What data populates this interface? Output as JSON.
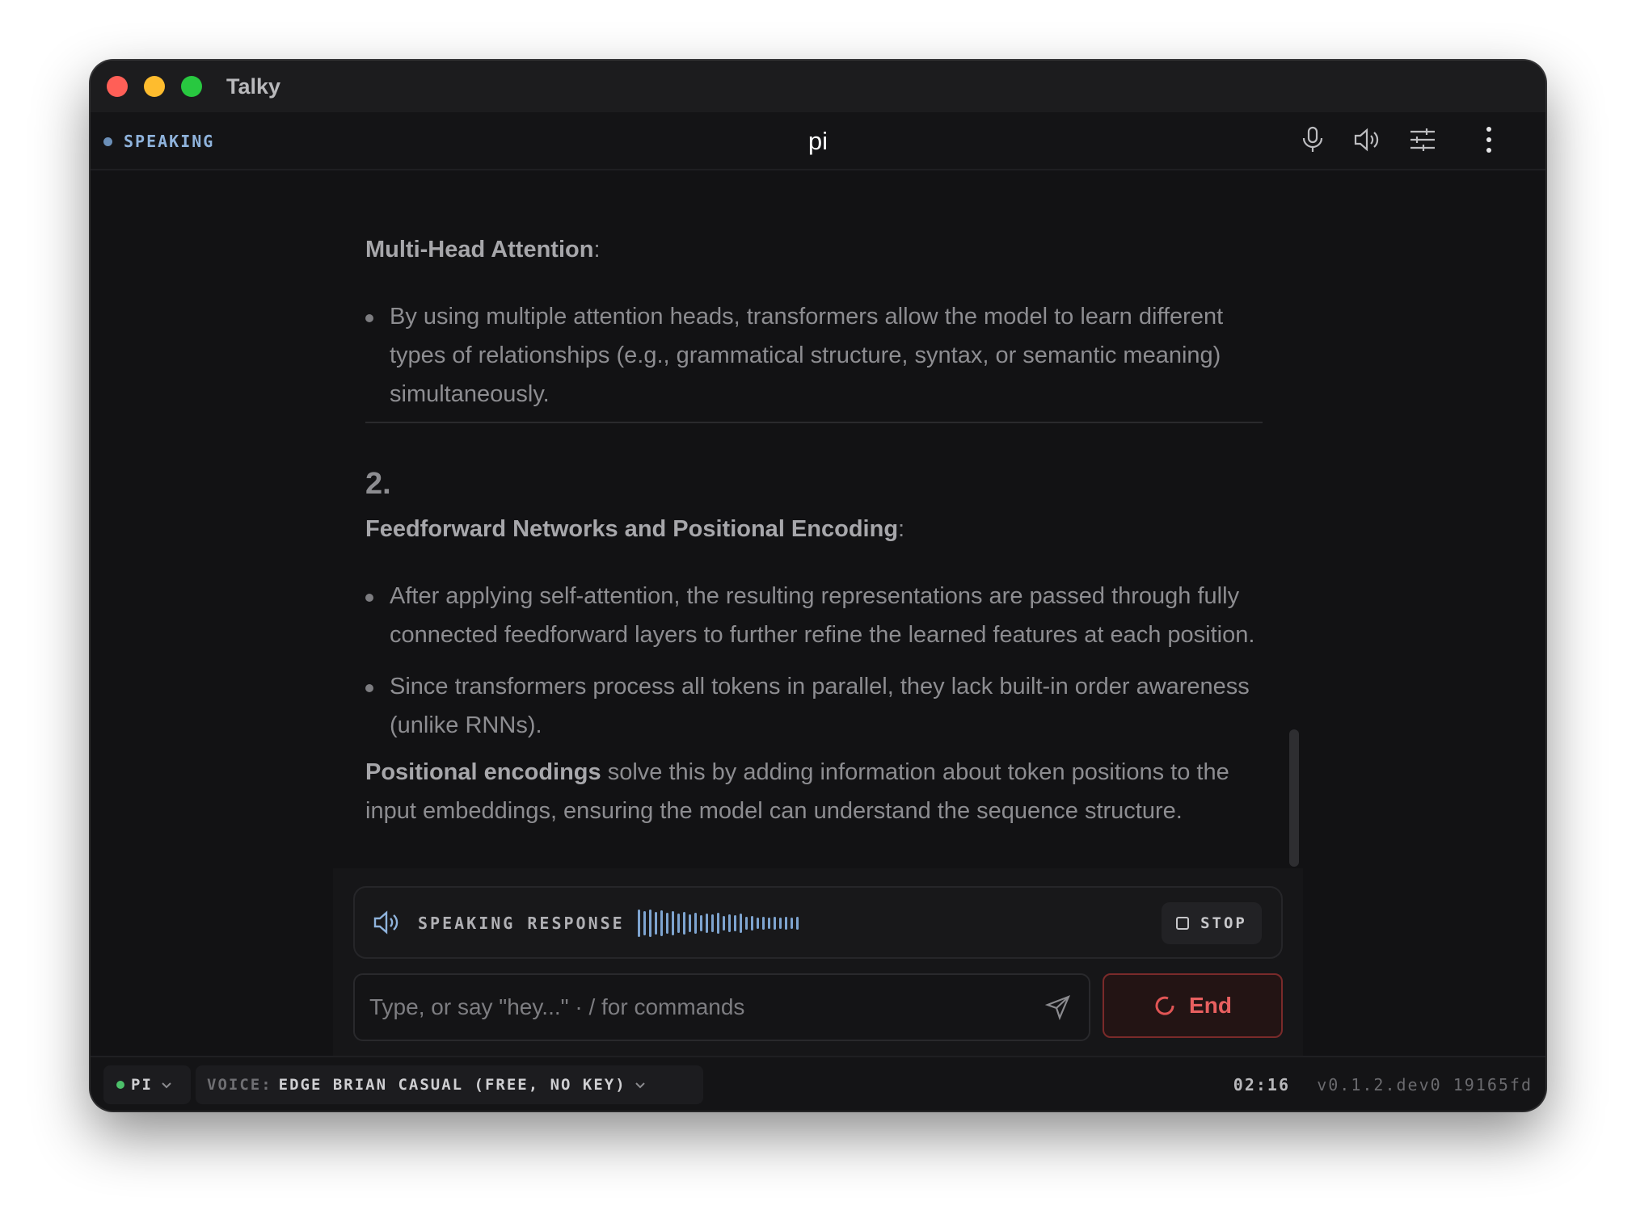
{
  "window": {
    "app_title": "Talky"
  },
  "toolbar": {
    "status": "SPEAKING",
    "conversation_title": "pi",
    "icons": [
      "microphone-icon",
      "speaker-icon",
      "sliders-icon",
      "more-vertical-icon"
    ]
  },
  "message": {
    "section1_heading": "Multi-Head Attention",
    "section1_heading_suffix": ":",
    "section1_bullets": [
      "By using multiple attention heads, transformers allow the model to learn different types of relationships (e.g., grammatical structure, syntax, or semantic meaning) simultaneously."
    ],
    "section2_number": "2.",
    "section2_heading": "Feedforward Networks and Positional Encoding",
    "section2_heading_suffix": ":",
    "section2_bullets": [
      "After applying self-attention, the resulting representations are passed through fully connected feedforward layers to further refine the learned features at each position.",
      "Since transformers process all tokens in parallel, they lack built-in order awareness (unlike RNNs)."
    ],
    "section2_para_bold": "Positional encodings",
    "section2_para_rest": " solve this by adding information about token positions to the input embeddings, ensuring the model can understand the sequence structure."
  },
  "speaking_bar": {
    "label": "SPEAKING RESPONSE",
    "stop_label": "STOP",
    "colors": {
      "accent": "#8fb3dc",
      "wave": "#7ea4d0"
    }
  },
  "composer": {
    "placeholder": "Type, or say \"hey...\" · / for commands",
    "value": "",
    "end_label": "End",
    "end_color": "#e86060"
  },
  "footer": {
    "model": "PI",
    "voice_key": "VOICE:",
    "voice_value": "EDGE BRIAN CASUAL (FREE, NO KEY)",
    "timer": "02:16",
    "version": "v0.1.2.dev0 19165fd"
  }
}
